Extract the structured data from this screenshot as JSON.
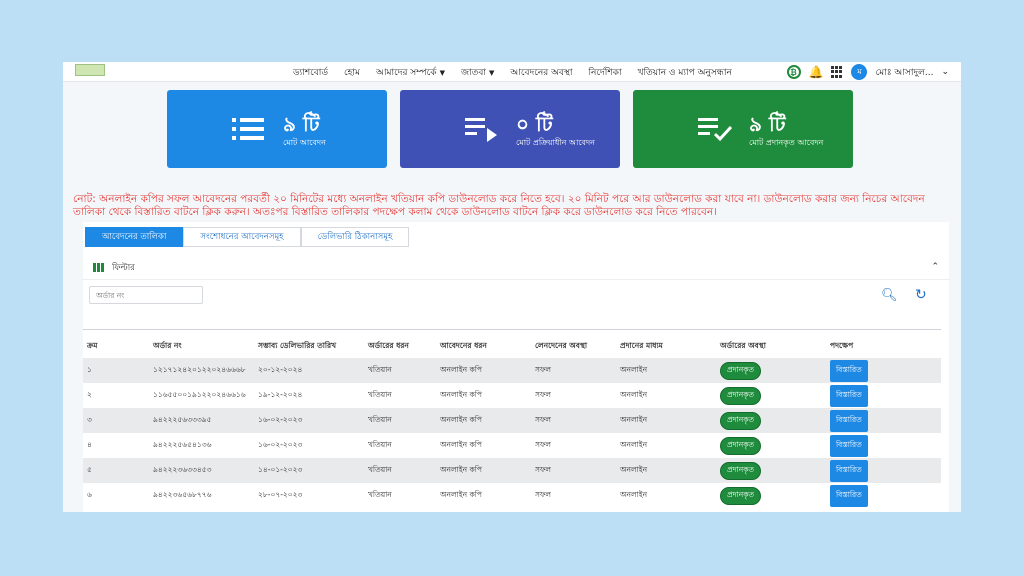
{
  "header": {
    "nav": [
      "ড্যাশবোর্ড",
      "হোম",
      "আমাদের সম্পর্কে",
      "জাতবা",
      "আবেদনের অবস্থা",
      "নির্দেশিকা",
      "খতিয়ান ও ম্যাপ অনুসন্ধান"
    ],
    "avatar_initial": "ম",
    "user_name": "মোঃ আসাদুল..."
  },
  "cards": [
    {
      "count": "৯ টি",
      "label": "মোট আবেদন",
      "color": "#1e88e5",
      "icon": "list-icon"
    },
    {
      "count": "০ টি",
      "label": "মোট প্রক্রিয়াধীন আবেদন",
      "color": "#3f51b5",
      "icon": "playlist-icon"
    },
    {
      "count": "৯ টি",
      "label": "মোট প্রদানকৃত আবেদন",
      "color": "#1e8c3c",
      "icon": "playlist-check-icon"
    }
  ],
  "note": "নোট: অনলাইন কপির সফল আবেদনের পরবর্তী ২০ মিনিটের মধ্যে অনলাইন খতিয়ান কপি ডাউনলোড করে নিতে হবে। ২০ মিনিট পরে আর ডাউনলোড করা যাবে না। ডাউনলোড করার জন্য নিচের আবেদন তালিকা থেকে বিস্তারিত বাটনে ক্লিক করুন। অতঃপর বিস্তারিত তালিকার পদক্ষেপ কলাম থেকে ডাউনলোড বাটনে ক্লিক করে ডাউনলোড করে নিতে পারবেন।",
  "tabs": [
    "আবেদনের তালিকা",
    "সংশোধনের আবেদনসমূহ",
    "ডেলিভারি ঠিকানাসমূহ"
  ],
  "filter": {
    "label": "ফিল্টার",
    "order_placeholder": "অর্ডার নং"
  },
  "table": {
    "headers": [
      "ক্রম",
      "অর্ডার নং",
      "সম্ভাব্য ডেলিভারির তারিখ",
      "অর্ডারের ধরন",
      "আবেদনের ধরন",
      "লেনদেনের অবস্থা",
      "প্রদানের মাধ্যম",
      "অর্ডারের অবস্থা",
      "পদক্ষেপ"
    ],
    "rows": [
      {
        "serial": "১",
        "order_no": "১২১৭১২৪২০১২২০২৪৬৬৬৮",
        "delivery_date": "২০-১২-২০২৪",
        "order_type": "খতিয়ান",
        "application_type": "অনলাইন কপি",
        "transaction_status": "সফল",
        "payment_method": "অনলাইন",
        "order_status": "প্রদানকৃত",
        "action": "বিস্তারিত"
      },
      {
        "serial": "২",
        "order_no": "১১৬৫৫০০১৯১২২০২৪৬৬১৬",
        "delivery_date": "১৯-১২-২০২৪",
        "order_type": "খতিয়ান",
        "application_type": "অনলাইন কপি",
        "transaction_status": "সফল",
        "payment_method": "অনলাইন",
        "order_status": "প্রদানকৃত",
        "action": "বিস্তারিত"
      },
      {
        "serial": "৩",
        "order_no": "৯৪২২২৫৬৩৩৩৯৫",
        "delivery_date": "১৬-০২-২০২৩",
        "order_type": "খতিয়ান",
        "application_type": "অনলাইন কপি",
        "transaction_status": "সফল",
        "payment_method": "অনলাইন",
        "order_status": "প্রদানকৃত",
        "action": "বিস্তারিত"
      },
      {
        "serial": "৪",
        "order_no": "৯৪২২২৫৬৫৪১৩৬",
        "delivery_date": "১৬-০২-২০২৩",
        "order_type": "খতিয়ান",
        "application_type": "অনলাইন কপি",
        "transaction_status": "সফল",
        "payment_method": "অনলাইন",
        "order_status": "প্রদানকৃত",
        "action": "বিস্তারিত"
      },
      {
        "serial": "৫",
        "order_no": "৯৪২২২৩৬৩৩৪৫৩",
        "delivery_date": "১৪-০১-২০২৩",
        "order_type": "খতিয়ান",
        "application_type": "অনলাইন কপি",
        "transaction_status": "সফল",
        "payment_method": "অনলাইন",
        "order_status": "প্রদানকৃত",
        "action": "বিস্তারিত"
      },
      {
        "serial": "৬",
        "order_no": "৯৪২২৩৬৫৬৮৭৭৬",
        "delivery_date": "২৮-০৭-২০২৩",
        "order_type": "খতিয়ান",
        "application_type": "অনলাইন কপি",
        "transaction_status": "সফল",
        "payment_method": "অনলাইন",
        "order_status": "প্রদানকৃত",
        "action": "বিস্তারিত"
      }
    ]
  }
}
